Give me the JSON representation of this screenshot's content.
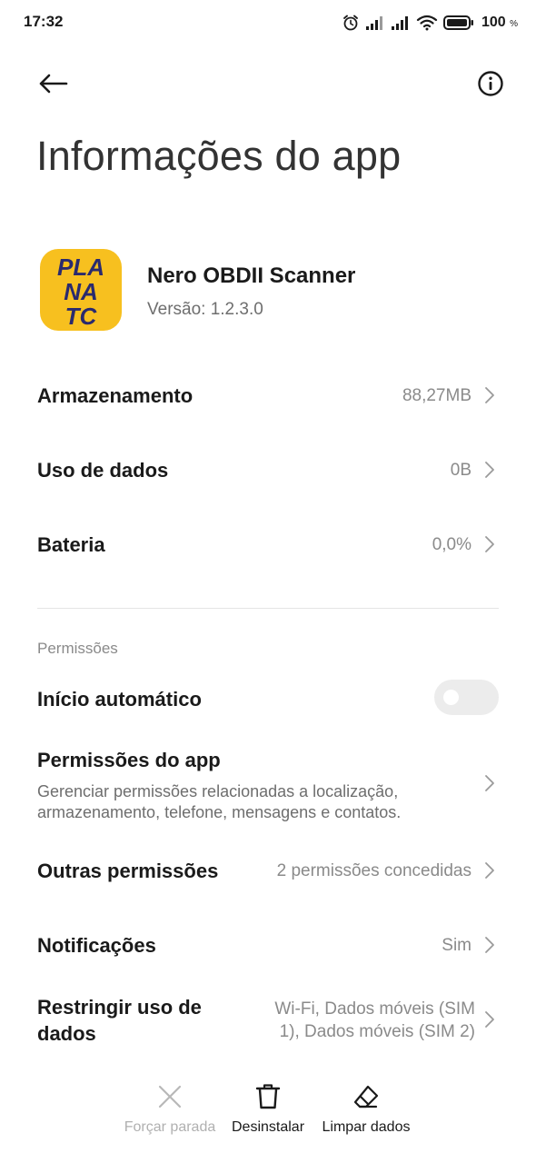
{
  "status_bar": {
    "time": "17:32",
    "battery_percent": "100",
    "battery_unit": "%",
    "icons": [
      "alarm-icon",
      "signal-icon",
      "signal-icon",
      "wifi-icon",
      "battery-icon"
    ]
  },
  "header": {
    "back_icon": "arrow-left-icon",
    "info_icon": "info-circle-icon",
    "title": "Informações do app"
  },
  "app": {
    "name": "Nero OBDII Scanner",
    "version": "Versão: 1.2.3.0",
    "icon_text": [
      "PLA",
      "NA",
      "TC"
    ],
    "icon_color": "#f7c01f",
    "icon_text_color": "#2a2a6e"
  },
  "info_rows": [
    {
      "label": "Armazenamento",
      "value": "88,27MB"
    },
    {
      "label": "Uso de dados",
      "value": "0B"
    },
    {
      "label": "Bateria",
      "value": "0,0%"
    }
  ],
  "permissions": {
    "section_label": "Permissões",
    "autostart": {
      "label": "Início automático",
      "enabled": false
    },
    "app_permissions": {
      "title": "Permissões do app",
      "subtitle": "Gerenciar permissões relacionadas a localização, armazenamento, telefone, mensagens e contatos."
    },
    "other_permissions": {
      "label": "Outras permissões",
      "value": "2 permissões concedidas"
    },
    "notifications": {
      "label": "Notificações",
      "value": "Sim"
    },
    "restrict_data": {
      "label": "Restringir uso de dados",
      "value": "Wi-Fi, Dados móveis (SIM 1), Dados móveis (SIM 2)"
    }
  },
  "bottom_actions": [
    {
      "label": "Forçar parada",
      "icon": "close-icon",
      "enabled": false
    },
    {
      "label": "Desinstalar",
      "icon": "trash-icon",
      "enabled": true
    },
    {
      "label": "Limpar dados",
      "icon": "eraser-icon",
      "enabled": true
    }
  ],
  "colors": {
    "primary_text": "#1a1a1a",
    "secondary_text": "#8a8a8a",
    "disabled_text": "#b0b0b0",
    "toggle_off": "#ececec"
  }
}
